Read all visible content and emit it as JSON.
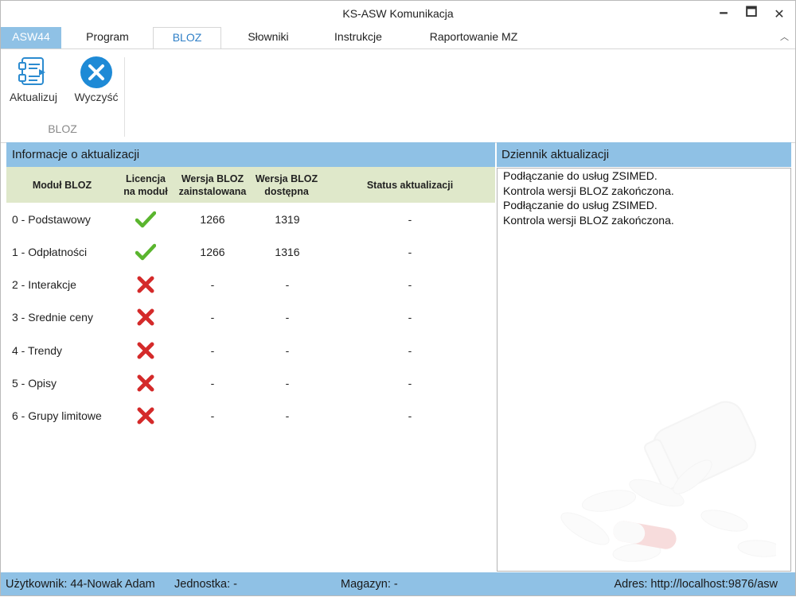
{
  "window": {
    "title": "KS-ASW Komunikacja",
    "minimize_glyph": "🗕",
    "maximize_glyph": "🗖",
    "close_glyph": "✕"
  },
  "ribbon": {
    "tabs": [
      {
        "label": "ASW44"
      },
      {
        "label": "Program"
      },
      {
        "label": "BLOZ"
      },
      {
        "label": "Słowniki"
      },
      {
        "label": "Instrukcje"
      },
      {
        "label": "Raportowanie MZ"
      }
    ],
    "active_tab": "BLOZ",
    "collapse_glyph": "︿",
    "buttons": [
      {
        "label": "Aktualizuj",
        "icon": "update-list-icon"
      },
      {
        "label": "Wyczyść",
        "icon": "clear-x-icon"
      }
    ],
    "group_label": "BLOZ"
  },
  "left_panel": {
    "title": "Informacje o aktualizacji",
    "columns": {
      "module": "Moduł BLOZ",
      "license_line1": "Licencja",
      "license_line2": "na moduł",
      "installed_line1": "Wersja BLOZ",
      "installed_line2": "zainstalowana",
      "available_line1": "Wersja BLOZ",
      "available_line2": "dostępna",
      "status": "Status aktualizacji"
    },
    "rows": [
      {
        "module": "0 - Podstawowy",
        "licensed": true,
        "installed": "1266",
        "available": "1319",
        "status": "-"
      },
      {
        "module": "1 - Odpłatności",
        "licensed": true,
        "installed": "1266",
        "available": "1316",
        "status": "-"
      },
      {
        "module": "2 - Interakcje",
        "licensed": false,
        "installed": "-",
        "available": "-",
        "status": "-"
      },
      {
        "module": "3 - Srednie ceny",
        "licensed": false,
        "installed": "-",
        "available": "-",
        "status": "-"
      },
      {
        "module": "4 - Trendy",
        "licensed": false,
        "installed": "-",
        "available": "-",
        "status": "-"
      },
      {
        "module": "5 - Opisy",
        "licensed": false,
        "installed": "-",
        "available": "-",
        "status": "-"
      },
      {
        "module": "6 - Grupy limitowe",
        "licensed": false,
        "installed": "-",
        "available": "-",
        "status": "-"
      }
    ]
  },
  "right_panel": {
    "title": "Dziennik aktualizacji",
    "log": [
      "Podłączanie do usług ZSIMED.",
      "Kontrola wersji BLOZ zakończona.",
      "Podłączanie do usług ZSIMED.",
      "Kontrola wersji BLOZ zakończona."
    ]
  },
  "status_bar": {
    "user": "Użytkownik: 44-Nowak Adam",
    "unit": "Jednostka: -",
    "warehouse": "Magazyn: -",
    "address": "Adres: http://localhost:9876/asw"
  },
  "colors": {
    "accent": "#8fc1e5",
    "active_tab_text": "#2e7fc7",
    "grid_header": "#dfe8ca",
    "check": "#5ab52e",
    "cross": "#d42a2a"
  }
}
